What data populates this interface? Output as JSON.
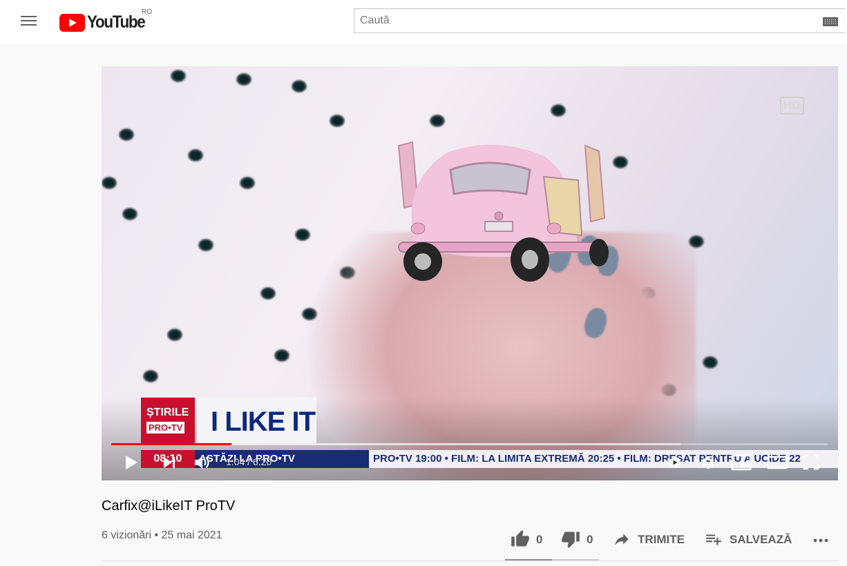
{
  "header": {
    "logo_text": "YouTube",
    "country_code": "RO",
    "search_placeholder": "Caută"
  },
  "video": {
    "hd_label": "HD",
    "overlay": {
      "brand_line1": "ȘTIRILE",
      "brand_line2": "PRO•TV",
      "show_title": "I LIKE IT",
      "ticker_time": "08:10",
      "ticker_text": "ASTĂZI LA PRO•TV",
      "ticker_scroll": "PRO•TV 19:00  •  FILM: LA LIMITA EXTREMĂ  20:25  •  FILM: DRESAT PENTRU A UCIDE  22"
    },
    "player": {
      "current_time": "1:04",
      "duration": "6:20",
      "time_separator": " / ",
      "played_fraction": 0.168,
      "buffered_fraction": 0.795
    }
  },
  "info": {
    "title": "Carfix@iLikeIT ProTV",
    "views": "6 vizionări",
    "separator": " • ",
    "date": "25 mai 2021",
    "likes": "0",
    "dislikes": "0",
    "share_label": "TRIMITE",
    "save_label": "SALVEAZĂ"
  },
  "colors": {
    "brand_red": "#ff0000",
    "text_primary": "#030303",
    "text_secondary": "#606060"
  }
}
